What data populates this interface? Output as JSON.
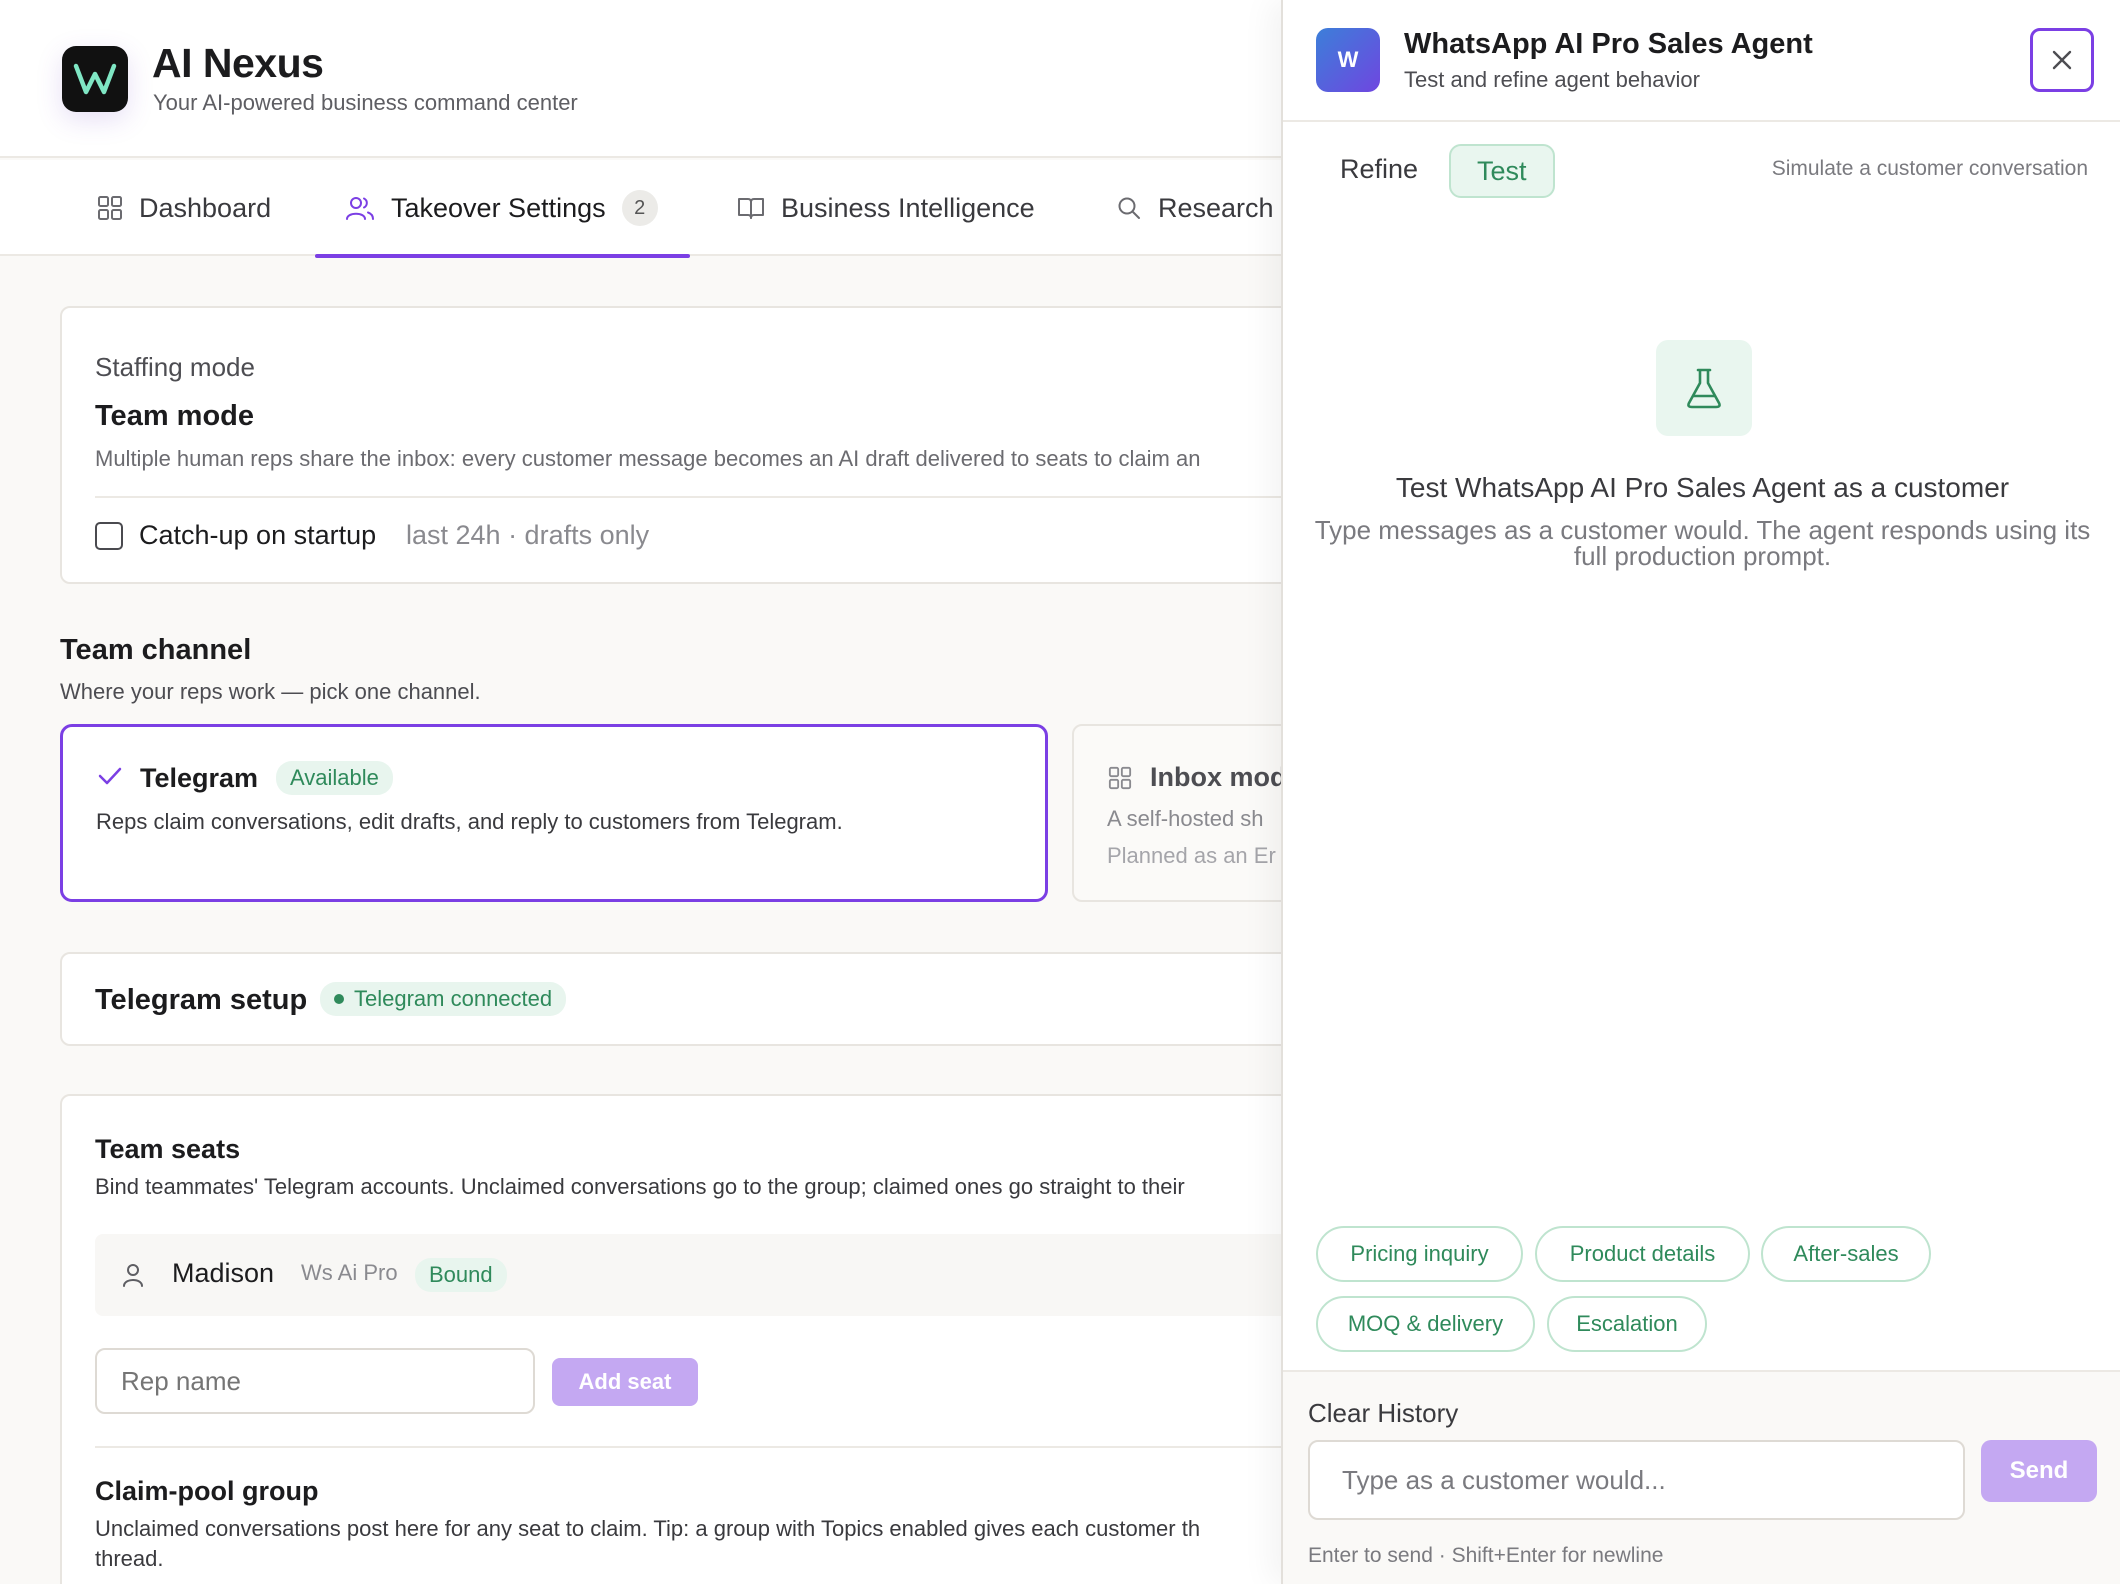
{
  "app": {
    "title": "AI Nexus",
    "subtitle": "Your AI-powered business command center"
  },
  "tabs": [
    {
      "label": "Dashboard",
      "icon": "grid-icon"
    },
    {
      "label": "Takeover Settings",
      "icon": "users-icon",
      "badge": "2",
      "active": true
    },
    {
      "label": "Business Intelligence",
      "icon": "book-icon"
    },
    {
      "label": "Research",
      "icon": "search-icon"
    }
  ],
  "staffing": {
    "heading": "Staffing mode",
    "mode_title": "Team mode",
    "mode_desc": "Multiple human reps share the inbox: every customer message becomes an AI draft delivered to seats to claim an",
    "catchup_label": "Catch-up on startup",
    "catchup_hint": "last 24h · drafts only",
    "catchup_checked": false
  },
  "team_channel": {
    "title": "Team channel",
    "subtitle": "Where your reps work — pick one channel.",
    "options": [
      {
        "name": "Telegram",
        "badge": "Available",
        "desc": "Reps claim conversations, edit drafts, and reply to customers from Telegram.",
        "selected": true
      },
      {
        "name": "Inbox mod",
        "desc": "A self-hosted sh",
        "note": "Planned as an Er",
        "selected": false
      }
    ]
  },
  "telegram_setup": {
    "title": "Telegram setup",
    "status": "Telegram connected"
  },
  "team_seats": {
    "title": "Team seats",
    "desc": "Bind teammates' Telegram accounts. Unclaimed conversations go to the group; claimed ones go straight to their",
    "seats": [
      {
        "name": "Madison",
        "account": "Ws Ai Pro",
        "status": "Bound"
      }
    ],
    "rep_placeholder": "Rep name",
    "add_label": "Add seat"
  },
  "claim_pool": {
    "title": "Claim-pool group",
    "desc_line1": "Unclaimed conversations post here for any seat to claim. Tip: a group with Topics enabled gives each customer th",
    "desc_line2": "thread."
  },
  "panel": {
    "avatar_letter": "W",
    "agent_name": "WhatsApp AI Pro Sales Agent",
    "agent_subtitle": "Test and refine agent behavior",
    "modes": {
      "refine": "Refine",
      "test": "Test",
      "active": "Test"
    },
    "mode_hint": "Simulate a customer conversation",
    "empty_title": "Test WhatsApp AI Pro Sales Agent as a customer",
    "empty_desc": "Type messages as a customer would. The agent responds using its full production prompt.",
    "chips": [
      "Pricing inquiry",
      "Product details",
      "After-sales",
      "MOQ & delivery",
      "Escalation"
    ],
    "clear_history": "Clear History",
    "input_placeholder": "Type as a customer would...",
    "send_label": "Send",
    "send_hint": "Enter to send · Shift+Enter for newline"
  },
  "colors": {
    "accent": "#7b3fe4",
    "green": "#2f8a5b",
    "green_bg": "#e9f6ef",
    "send_disabled": "#c4a8f2"
  }
}
